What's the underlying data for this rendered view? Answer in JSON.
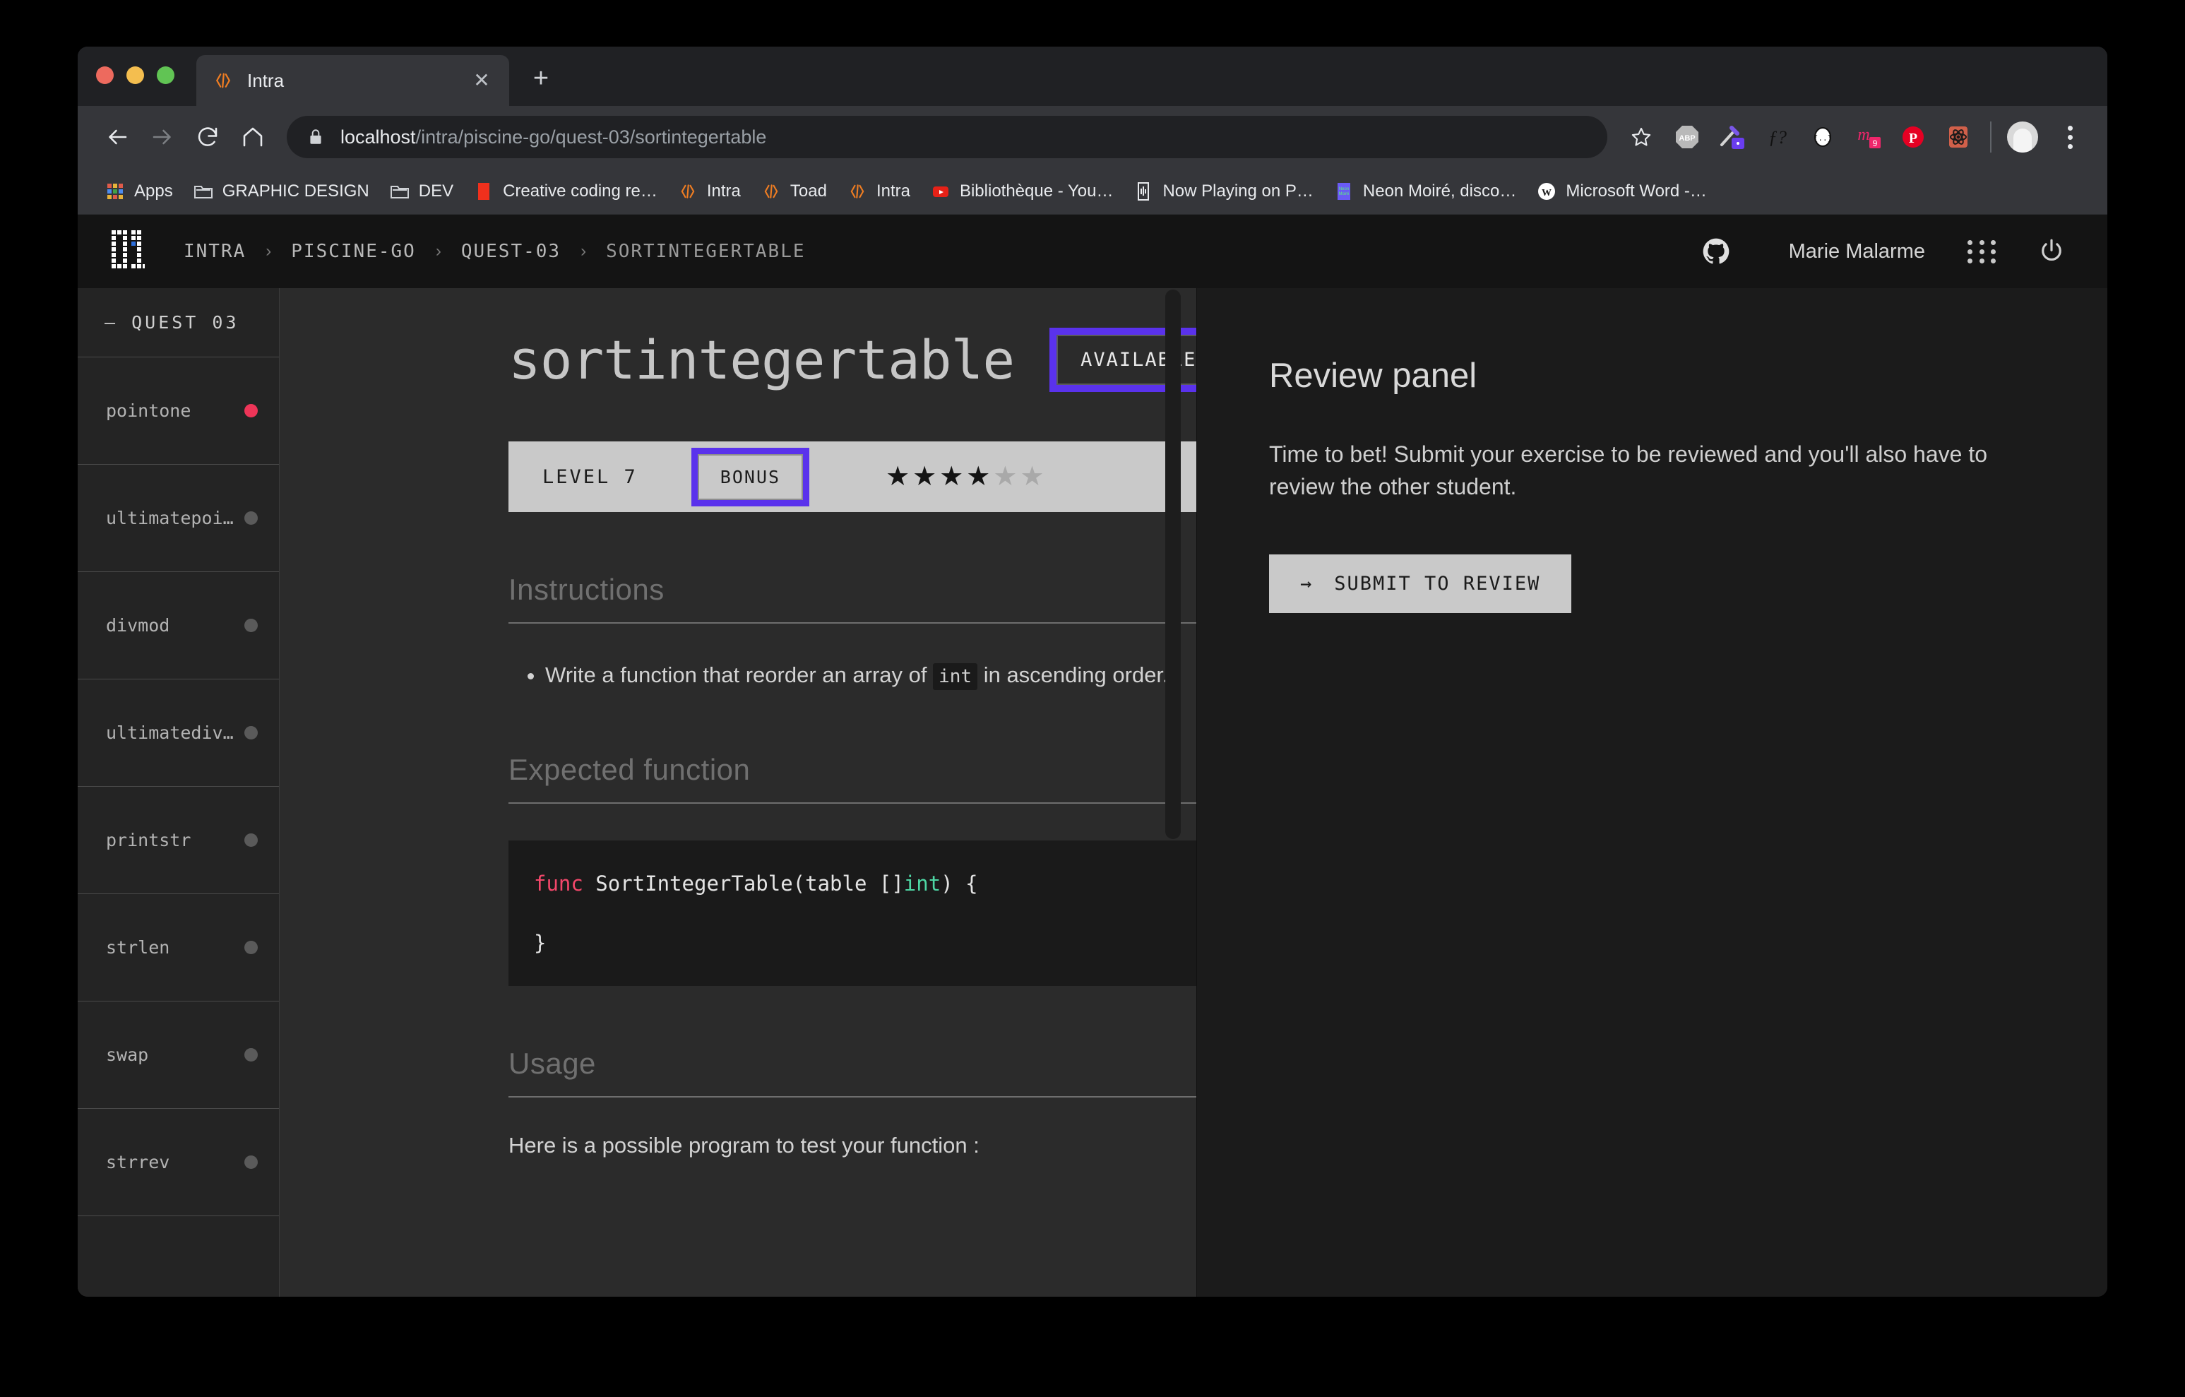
{
  "browser": {
    "tab": {
      "title": "Intra",
      "favicon_icon": "code-brackets-icon",
      "close_icon": "close-icon"
    },
    "new_tab_label": "+",
    "nav": {
      "back_icon": "arrow-left-icon",
      "forward_icon": "arrow-right-icon",
      "reload_icon": "reload-icon",
      "home_icon": "home-icon"
    },
    "omnibox": {
      "lock_icon": "lock-icon",
      "url_host": "localhost",
      "url_path": "/intra/piscine-go/quest-03/sortintegertable",
      "star_icon": "star-icon"
    },
    "extensions": [
      {
        "name": "adblock-plus-icon",
        "label": "ABP"
      },
      {
        "name": "eyedropper-icon",
        "label": ""
      },
      {
        "name": "font-inspect-icon",
        "label": "ƒ?"
      },
      {
        "name": "json-viewer-icon",
        "label": "{…}"
      },
      {
        "name": "mailtrack-icon",
        "label": "9"
      },
      {
        "name": "pinterest-icon",
        "label": "P"
      },
      {
        "name": "react-devtools-icon",
        "label": ""
      }
    ],
    "avatar_icon": "profile-avatar",
    "menu_icon": "kebab-menu-icon",
    "bookmarks": [
      {
        "label": "Apps",
        "icon": "apps-grid-icon"
      },
      {
        "label": "GRAPHIC DESIGN",
        "icon": "folder-icon"
      },
      {
        "label": "DEV",
        "icon": "folder-icon"
      },
      {
        "label": "Creative coding re…",
        "icon": "red-square-icon"
      },
      {
        "label": "Intra",
        "icon": "code-brackets-icon"
      },
      {
        "label": "Toad",
        "icon": "code-brackets-icon"
      },
      {
        "label": "Intra",
        "icon": "code-brackets-icon"
      },
      {
        "label": "Bibliothèque - You…",
        "icon": "youtube-icon"
      },
      {
        "label": "Now Playing on P…",
        "icon": "waveform-icon"
      },
      {
        "label": "Neon Moiré, disco…",
        "icon": "neon-moire-icon"
      },
      {
        "label": "Microsoft Word -…",
        "icon": "word-icon"
      }
    ]
  },
  "app": {
    "logo_icon": "pixel-01-logo",
    "breadcrumb": [
      "INTRA",
      "PISCINE-GO",
      "QUEST-03",
      "SORTINTEGERTABLE"
    ],
    "breadcrumb_separator": "›",
    "github_icon": "github-icon",
    "username": "Marie Malarme",
    "grid_icon": "apps-grid-icon",
    "power_icon": "power-icon"
  },
  "sidebar": {
    "quest_label": "— QUEST 03",
    "items": [
      {
        "label": "pointone",
        "status": "active"
      },
      {
        "label": "ultimatepoi…",
        "status": "idle"
      },
      {
        "label": "divmod",
        "status": "idle"
      },
      {
        "label": "ultimatediv…",
        "status": "idle"
      },
      {
        "label": "printstr",
        "status": "idle"
      },
      {
        "label": "strlen",
        "status": "idle"
      },
      {
        "label": "swap",
        "status": "idle"
      },
      {
        "label": "strrev",
        "status": "idle"
      }
    ]
  },
  "main": {
    "title": "sortintegertable",
    "availability": {
      "label": "AVAILABLE",
      "indicator_icon": "status-dot-icon"
    },
    "meta": {
      "level": "LEVEL 7",
      "bonus": "BONUS",
      "stars_filled": 4,
      "stars_total": 6,
      "add_icon": "plus-icon"
    },
    "sections": {
      "instructions": {
        "heading": "Instructions",
        "bullet_pre": "Write a function that reorder an array of",
        "bullet_code": "int",
        "bullet_post": "in ascending order."
      },
      "expected_function": {
        "heading": "Expected function",
        "code_kw": "func",
        "code_name": " SortIntegerTable(table []",
        "code_type": "int",
        "code_tail": ") {",
        "code_close": "}"
      },
      "usage": {
        "heading": "Usage",
        "text": "Here is a possible program to test your function :"
      }
    }
  },
  "review_panel": {
    "title": "Review panel",
    "description": "Time to bet! Submit your exercise to be reviewed and you'll also have to review the other student.",
    "submit_arrow": "→",
    "submit_label": "SUBMIT TO REVIEW"
  },
  "colors": {
    "accent_purple": "#5a32ec",
    "status_active": "#ee3558",
    "page_bg": "#1b1b1b",
    "main_bg": "#2b2b2b"
  }
}
